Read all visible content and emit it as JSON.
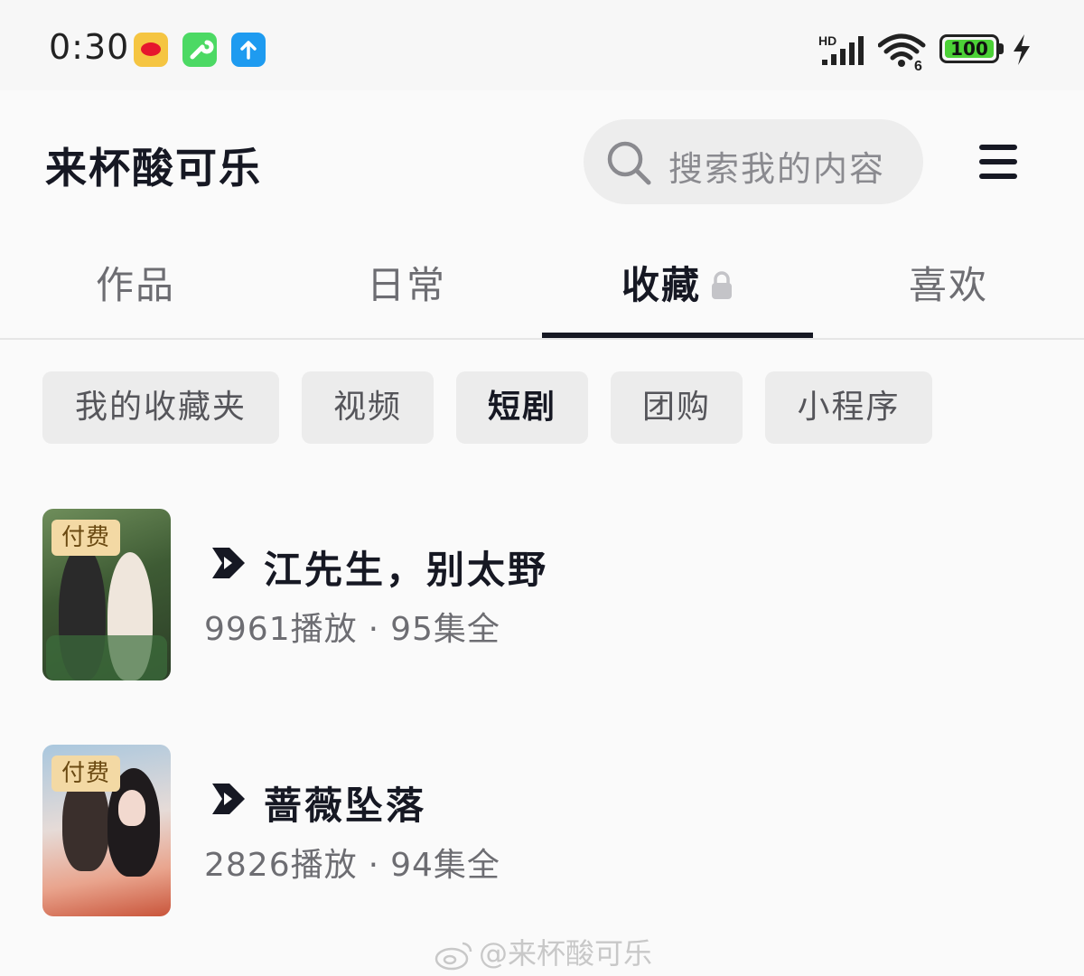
{
  "status_bar": {
    "time": "0:30",
    "network": "HD",
    "battery": "100",
    "wifi_label": "6"
  },
  "header": {
    "profile_name": "来杯酸可乐",
    "search_placeholder": "搜索我的内容"
  },
  "tabs": [
    {
      "label": "作品",
      "active": false
    },
    {
      "label": "日常",
      "active": false
    },
    {
      "label": "收藏",
      "active": true
    },
    {
      "label": "喜欢",
      "active": false
    }
  ],
  "filters": [
    {
      "label": "我的收藏夹",
      "active": false
    },
    {
      "label": "视频",
      "active": false
    },
    {
      "label": "短剧",
      "active": true
    },
    {
      "label": "团购",
      "active": false
    },
    {
      "label": "小程序",
      "active": false
    }
  ],
  "dramas": [
    {
      "badge": "付费",
      "title": "江先生，别太野",
      "plays": "9961播放",
      "separator": "·",
      "episodes": "95集全"
    },
    {
      "badge": "付费",
      "title": "蔷薇坠落",
      "plays": "2826播放",
      "separator": "·",
      "episodes": "94集全"
    }
  ],
  "watermark": "@来杯酸可乐",
  "colors": {
    "primary_text": "#161823",
    "paid_badge_bg": "#f3d9a4",
    "battery_green": "#4cd137"
  }
}
